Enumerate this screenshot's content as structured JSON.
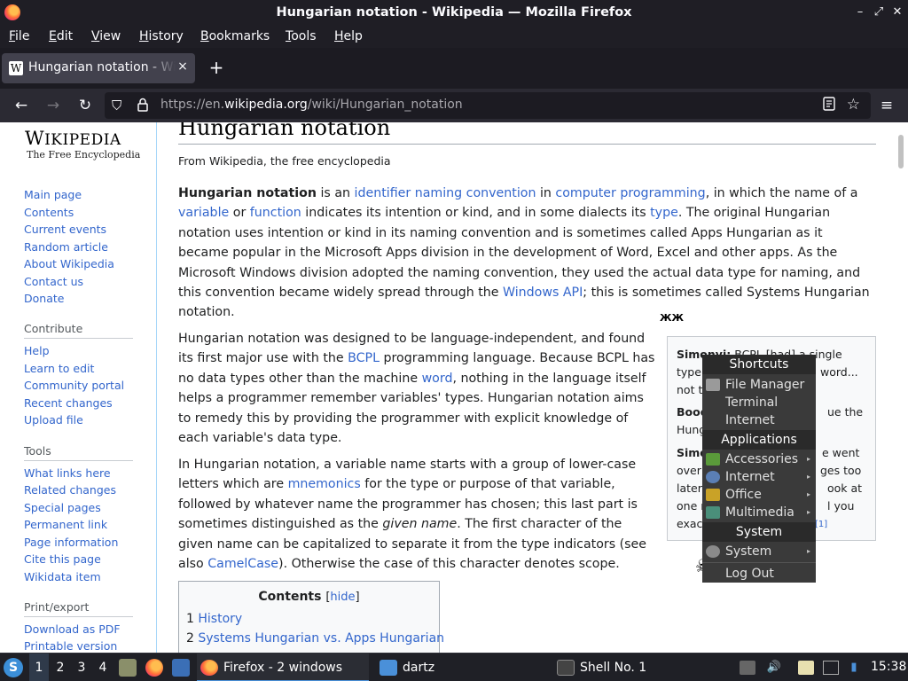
{
  "window": {
    "title": "Hungarian notation - Wikipedia — Mozilla Firefox",
    "controls": {
      "minimize": "–",
      "maximize": "⤢",
      "close": "✕"
    }
  },
  "menubar": {
    "items": [
      {
        "label": "File",
        "key": "F",
        "rest": "ile"
      },
      {
        "label": "Edit",
        "key": "E",
        "rest": "dit"
      },
      {
        "label": "View",
        "key": "V",
        "rest": "iew"
      },
      {
        "label": "History",
        "key": "H",
        "rest": "istory"
      },
      {
        "label": "Bookmarks",
        "key": "B",
        "rest": "ookmarks"
      },
      {
        "label": "Tools",
        "key": "T",
        "rest": "ools"
      },
      {
        "label": "Help",
        "key": "H",
        "rest": "elp"
      }
    ]
  },
  "tabs": {
    "active_title": "Hungarian notation - Wikipedia",
    "favicon": "W",
    "close": "×",
    "new_tab": "+"
  },
  "navbar": {
    "url_prefix": "https://en.",
    "url_domain": "wikipedia.org",
    "url_path": "/wiki/Hungarian_notation"
  },
  "wiki": {
    "wordmark": "Wikipedia",
    "tagline": "The Free Encyclopedia",
    "nav_links": [
      "Main page",
      "Contents",
      "Current events",
      "Random article",
      "About Wikipedia",
      "Contact us",
      "Donate"
    ],
    "contribute_heading": "Contribute",
    "contribute_links": [
      "Help",
      "Learn to edit",
      "Community portal",
      "Recent changes",
      "Upload file"
    ],
    "tools_heading": "Tools",
    "tools_links": [
      "What links here",
      "Related changes",
      "Special pages",
      "Permanent link",
      "Page information",
      "Cite this page",
      "Wikidata item"
    ],
    "print_heading": "Print/export",
    "print_links": [
      "Download as PDF",
      "Printable version"
    ]
  },
  "article": {
    "title": "Hungarian notation",
    "from": "From Wikipedia, the free encyclopedia",
    "p1": {
      "bold": "Hungarian notation",
      "t1": " is an ",
      "l1": "identifier naming convention",
      "t2": " in ",
      "l2": "computer programming",
      "t3": ", in which the name of a ",
      "l3": "variable",
      "t4": " or ",
      "l4": "function",
      "t5": " indicates its intention or kind, and in some dialects its ",
      "l5": "type",
      "t6": ". The original Hungarian notation uses intention or kind in its naming convention and is sometimes called Apps Hungarian as it became popular in the Microsoft Apps division in the development of Word, Excel and other apps. As the Microsoft Windows division adopted the naming convention, they used the actual data type for naming, and this convention became widely spread through the ",
      "l6": "Windows API",
      "t7": "; this is sometimes called Systems Hungarian notation."
    },
    "p2": {
      "t1": "Hungarian notation was designed to be language-independent, and found its first major use with the ",
      "l1": "BCPL",
      "t2": " programming language. Because BCPL has no data types other than the machine ",
      "l2": "word",
      "t3": ", nothing in the language itself helps a programmer remember variables' types. Hungarian notation aims to remedy this by providing the programmer with explicit knowledge of each variable's data type."
    },
    "p3": {
      "t1": "In Hungarian notation, a variable name starts with a group of lower-case letters which are ",
      "l1": "mnemonics",
      "t2": " for the type or purpose of that variable, followed by whatever name the programmer has chosen; this last part is sometimes distinguished as the ",
      "em": "given name",
      "t3": ". The first character of the given name can be capitalized to separate it from the type indicators (see also ",
      "l2": "CamelCase",
      "t4": "). Otherwise the case of this character denotes scope."
    },
    "toc": {
      "title": "Contents",
      "hide": "hide",
      "items": [
        {
          "num": "1",
          "label": "History"
        },
        {
          "num": "2",
          "label": "Systems Hungarian vs. Apps Hungarian"
        }
      ]
    },
    "quote_lines": [
      {
        "bold": "Simonyi:",
        "text": " BCPL [had] a single"
      },
      {
        "bold": "",
        "text": "type"
      },
      {
        "bold": "",
        "text": "not t"
      },
      {
        "bold": "Booc",
        "text": ""
      },
      {
        "bold": "",
        "text": "Hung"
      },
      {
        "bold": "Simo",
        "text": ""
      },
      {
        "bold": "",
        "text": "over"
      },
      {
        "bold": "",
        "text": "later"
      },
      {
        "bold": "",
        "text": "one r"
      },
      {
        "bold": "",
        "text": "exac"
      }
    ],
    "quote_tail": [
      {
        "text": "word..."
      },
      {
        "text": "ue the"
      },
      {
        "text": "e went"
      },
      {
        "text": "ges too"
      },
      {
        "text": "ook at"
      },
      {
        "text": "l you"
      }
    ],
    "quote_ref": "[1]"
  },
  "desktop_menu": {
    "shortcuts_heading": "Shortcuts",
    "shortcuts": [
      "File Manager",
      "Terminal",
      "Internet"
    ],
    "applications_heading": "Applications",
    "applications": [
      "Accessories",
      "Internet",
      "Office",
      "Multimedia"
    ],
    "system_heading": "System",
    "system_items": [
      "System",
      "Log Out"
    ],
    "submenu_arrow": "▸"
  },
  "taskbar": {
    "workspaces": [
      "1",
      "2",
      "3",
      "4"
    ],
    "tasks": [
      {
        "label": "Firefox - 2 windows",
        "icon": "firefox-icon",
        "color": "#ff7139"
      },
      {
        "label": "dartz",
        "icon": "folder-icon",
        "color": "#4a90d9"
      },
      {
        "label": "Shell No. 1",
        "icon": "terminal-icon",
        "color": "#555555"
      }
    ],
    "clock": "15:38"
  },
  "colors": {
    "link": "#3366cc",
    "chrome_dark": "#1c1b22",
    "menu_bg": "#3a3a3a",
    "taskbar_bg": "#1f2026"
  }
}
